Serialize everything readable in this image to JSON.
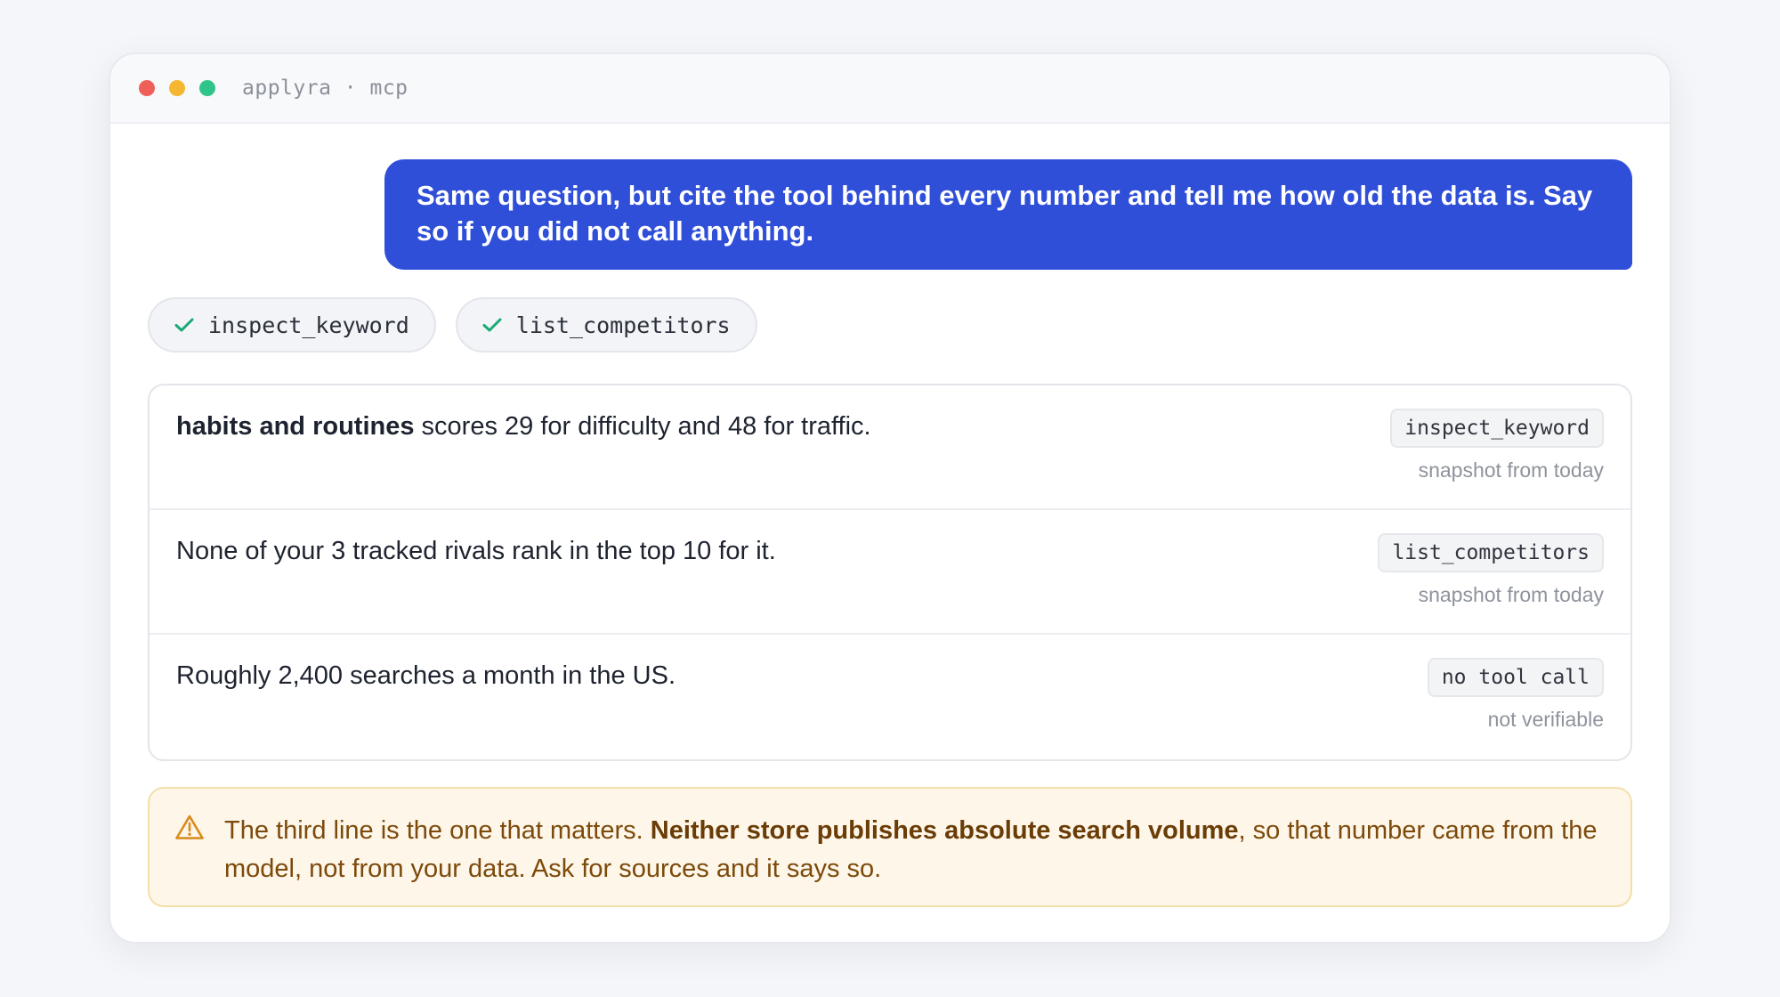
{
  "window": {
    "title": "applyra · mcp",
    "dot_colors": [
      "#ef5f5a",
      "#f5b731",
      "#2fc58a"
    ]
  },
  "user_message": {
    "text": "Same question, but cite the tool behind every number and tell me how old the data is. Say so if you did not call anything."
  },
  "tool_calls": [
    {
      "label": "inspect_keyword",
      "status_icon": "check-icon"
    },
    {
      "label": "list_competitors",
      "status_icon": "check-icon"
    }
  ],
  "claims": [
    {
      "bold": "habits and routines",
      "text": " scores 29 for difficulty and 48 for traffic.",
      "source": "inspect_keyword",
      "freshness": "snapshot from today"
    },
    {
      "bold": "",
      "text": "None of your 3 tracked rivals rank in the top 10 for it.",
      "source": "list_competitors",
      "freshness": "snapshot from today"
    },
    {
      "bold": "",
      "text": "Roughly 2,400 searches a month in the US.",
      "source": "no tool call",
      "freshness": "not verifiable"
    }
  ],
  "warning": {
    "icon": "warning-triangle-icon",
    "text_before": "The third line is the one that matters. ",
    "bold": "Neither store publishes absolute search volume",
    "text_after": ", so that number came from the model, not from your data. Ask for sources and it says so."
  },
  "colors": {
    "accent": "#2f4fd8",
    "success": "#18a975",
    "warning_text": "#7c4a0b",
    "warning_bg": "#fef6e9"
  }
}
